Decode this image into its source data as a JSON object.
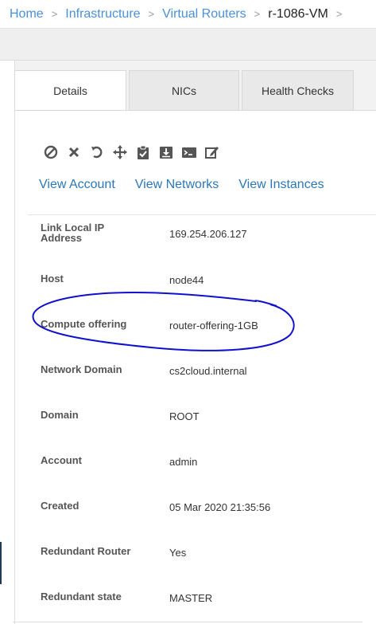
{
  "breadcrumb": {
    "items": [
      "Home",
      "Infrastructure",
      "Virtual Routers"
    ],
    "current": "r-1086-VM",
    "separator": ">"
  },
  "tabs": [
    {
      "label": "Details",
      "active": true
    },
    {
      "label": "NICs",
      "active": false
    },
    {
      "label": "Health Checks",
      "active": false
    }
  ],
  "actions": [
    {
      "icon": "stop-icon"
    },
    {
      "icon": "destroy-icon"
    },
    {
      "icon": "reboot-icon"
    },
    {
      "icon": "migrate-icon"
    },
    {
      "icon": "clipboard-check-icon"
    },
    {
      "icon": "download-icon"
    },
    {
      "icon": "console-icon"
    },
    {
      "icon": "edit-icon"
    }
  ],
  "links": {
    "view_account": "View Account",
    "view_networks": "View Networks",
    "view_instances": "View Instances"
  },
  "details": [
    {
      "label": "Link Local IP Address",
      "value": "169.254.206.127"
    },
    {
      "label": "Host",
      "value": "node44"
    },
    {
      "label": "Compute offering",
      "value": "router-offering-1GB"
    },
    {
      "label": "Network Domain",
      "value": "cs2cloud.internal"
    },
    {
      "label": "Domain",
      "value": "ROOT"
    },
    {
      "label": "Account",
      "value": "admin"
    },
    {
      "label": "Created",
      "value": "05 Mar 2020 21:35:56"
    },
    {
      "label": "Redundant Router",
      "value": "Yes"
    },
    {
      "label": "Redundant state",
      "value": "MASTER"
    }
  ],
  "colors": {
    "link": "#2b77b9",
    "breadcrumb_link": "#4a90d9",
    "annotation": "#1010d0"
  }
}
